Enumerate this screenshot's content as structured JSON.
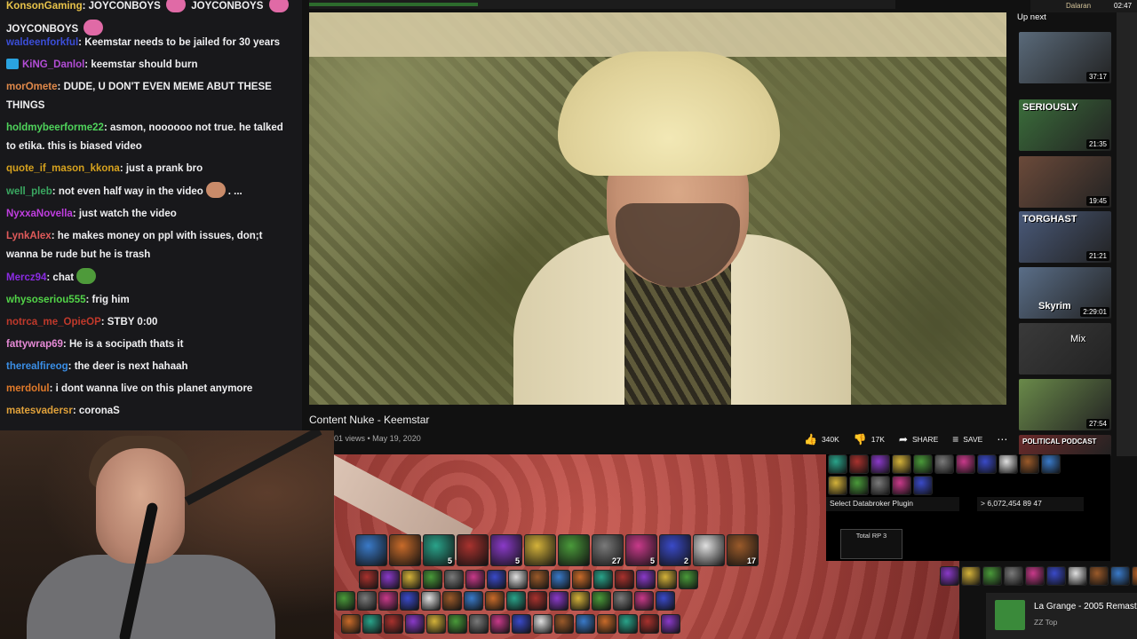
{
  "chat": {
    "top": [
      {
        "user": "KonsonGaming",
        "user_color": "#e8c34a",
        "text": "JOYCONBOYS",
        "text2": "JOYCONBOYS"
      },
      {
        "user": "",
        "user_color": "#efeff1",
        "text": "JOYCONBOYS"
      }
    ],
    "messages": [
      {
        "user": "waldeenforkful",
        "color": "#3b4ed8",
        "text": "Keemstar needs to be jailed for 30 years"
      },
      {
        "user": "KiNG_Danlol",
        "color": "#b34dd6",
        "text": "keemstar should burn",
        "badge": true
      },
      {
        "user": "morOmete",
        "color": "#e0894a",
        "text": "DUDE, U DON'T EVEN MEME ABUT THESE THINGS"
      },
      {
        "user": "holdmybeerforme22",
        "color": "#4fd35b",
        "text": "asmon, noooooo not true. he talked to etika. this is biased video"
      },
      {
        "user": "quote_if_mason_kkona",
        "color": "#d6a21e",
        "text": "just a prank bro"
      },
      {
        "user": "well_pleb",
        "color": "#3aa861",
        "text": "not even half way in the video",
        "emote_after": ". ..."
      },
      {
        "user": "NyxxaNovella",
        "color": "#c03ee0",
        "text": "just watch the video"
      },
      {
        "user": "LynkAlex",
        "color": "#e05a5a",
        "text": "he makes money on ppl with issues, don;t wanna be rude but he is trash"
      },
      {
        "user": "Mercz94",
        "color": "#8a2be2",
        "text": "chat"
      },
      {
        "user": "whysoseriou555",
        "color": "#52d448",
        "text": "frig him"
      },
      {
        "user": "notrca_me_OpieOP",
        "color": "#c0392b",
        "text": "STBY 0:00"
      },
      {
        "user": "fattywrap69",
        "color": "#e68ad6",
        "text": "He is a socipath thats it"
      },
      {
        "user": "therealfireog",
        "color": "#3a8ee6",
        "text": "the deer is next hahaah"
      },
      {
        "user": "merdolul",
        "color": "#e07a2a",
        "text": "i dont wanna live on this planet anymore"
      },
      {
        "user": "matesvadersr",
        "color": "#e0a13a",
        "text": "coronaS"
      }
    ]
  },
  "video": {
    "title": "Content Nuke - Keemstar",
    "meta": "01 views • May 19, 2020",
    "likes": "340K",
    "dislikes": "17K",
    "share": "SHARE",
    "save": "SAVE"
  },
  "upnext": {
    "label": "Up next",
    "items": [
      {
        "caption": "",
        "duration": "37:17",
        "color": "#5a6a7a"
      },
      {
        "caption": "SERIOUSLY",
        "duration": "21:35",
        "color": "#3b6e3b"
      },
      {
        "caption": "",
        "duration": "19:45",
        "color": "#6b4a3a"
      },
      {
        "caption": "TORGHAST",
        "duration": "21:21",
        "color": "#4a5a7a"
      },
      {
        "caption": "Skyrim",
        "duration": "2:29:01",
        "color": "#5a6e88"
      },
      {
        "caption": "Mix",
        "duration": "",
        "color": "#3a3a3a"
      },
      {
        "caption": "",
        "duration": "27:54",
        "color": "#6a8a4a"
      },
      {
        "caption": "POLITICAL PODCAST",
        "duration": "",
        "color": "#6a2a2a"
      }
    ]
  },
  "game": {
    "broker": "Select Databroker Plugin",
    "gold": "6,072,454",
    "silver": "89",
    "copper": "47",
    "rp_label": "Total RP 3",
    "slots_row1": [
      "",
      "",
      "5",
      "",
      "5",
      "",
      "",
      "27",
      "5",
      "2",
      "",
      "17"
    ],
    "nowplaying_title": "La Grange - 2005 Remaster",
    "nowplaying_artist": "ZZ Top"
  },
  "topbar": {
    "server": "Dalaran",
    "time": "02:47"
  }
}
